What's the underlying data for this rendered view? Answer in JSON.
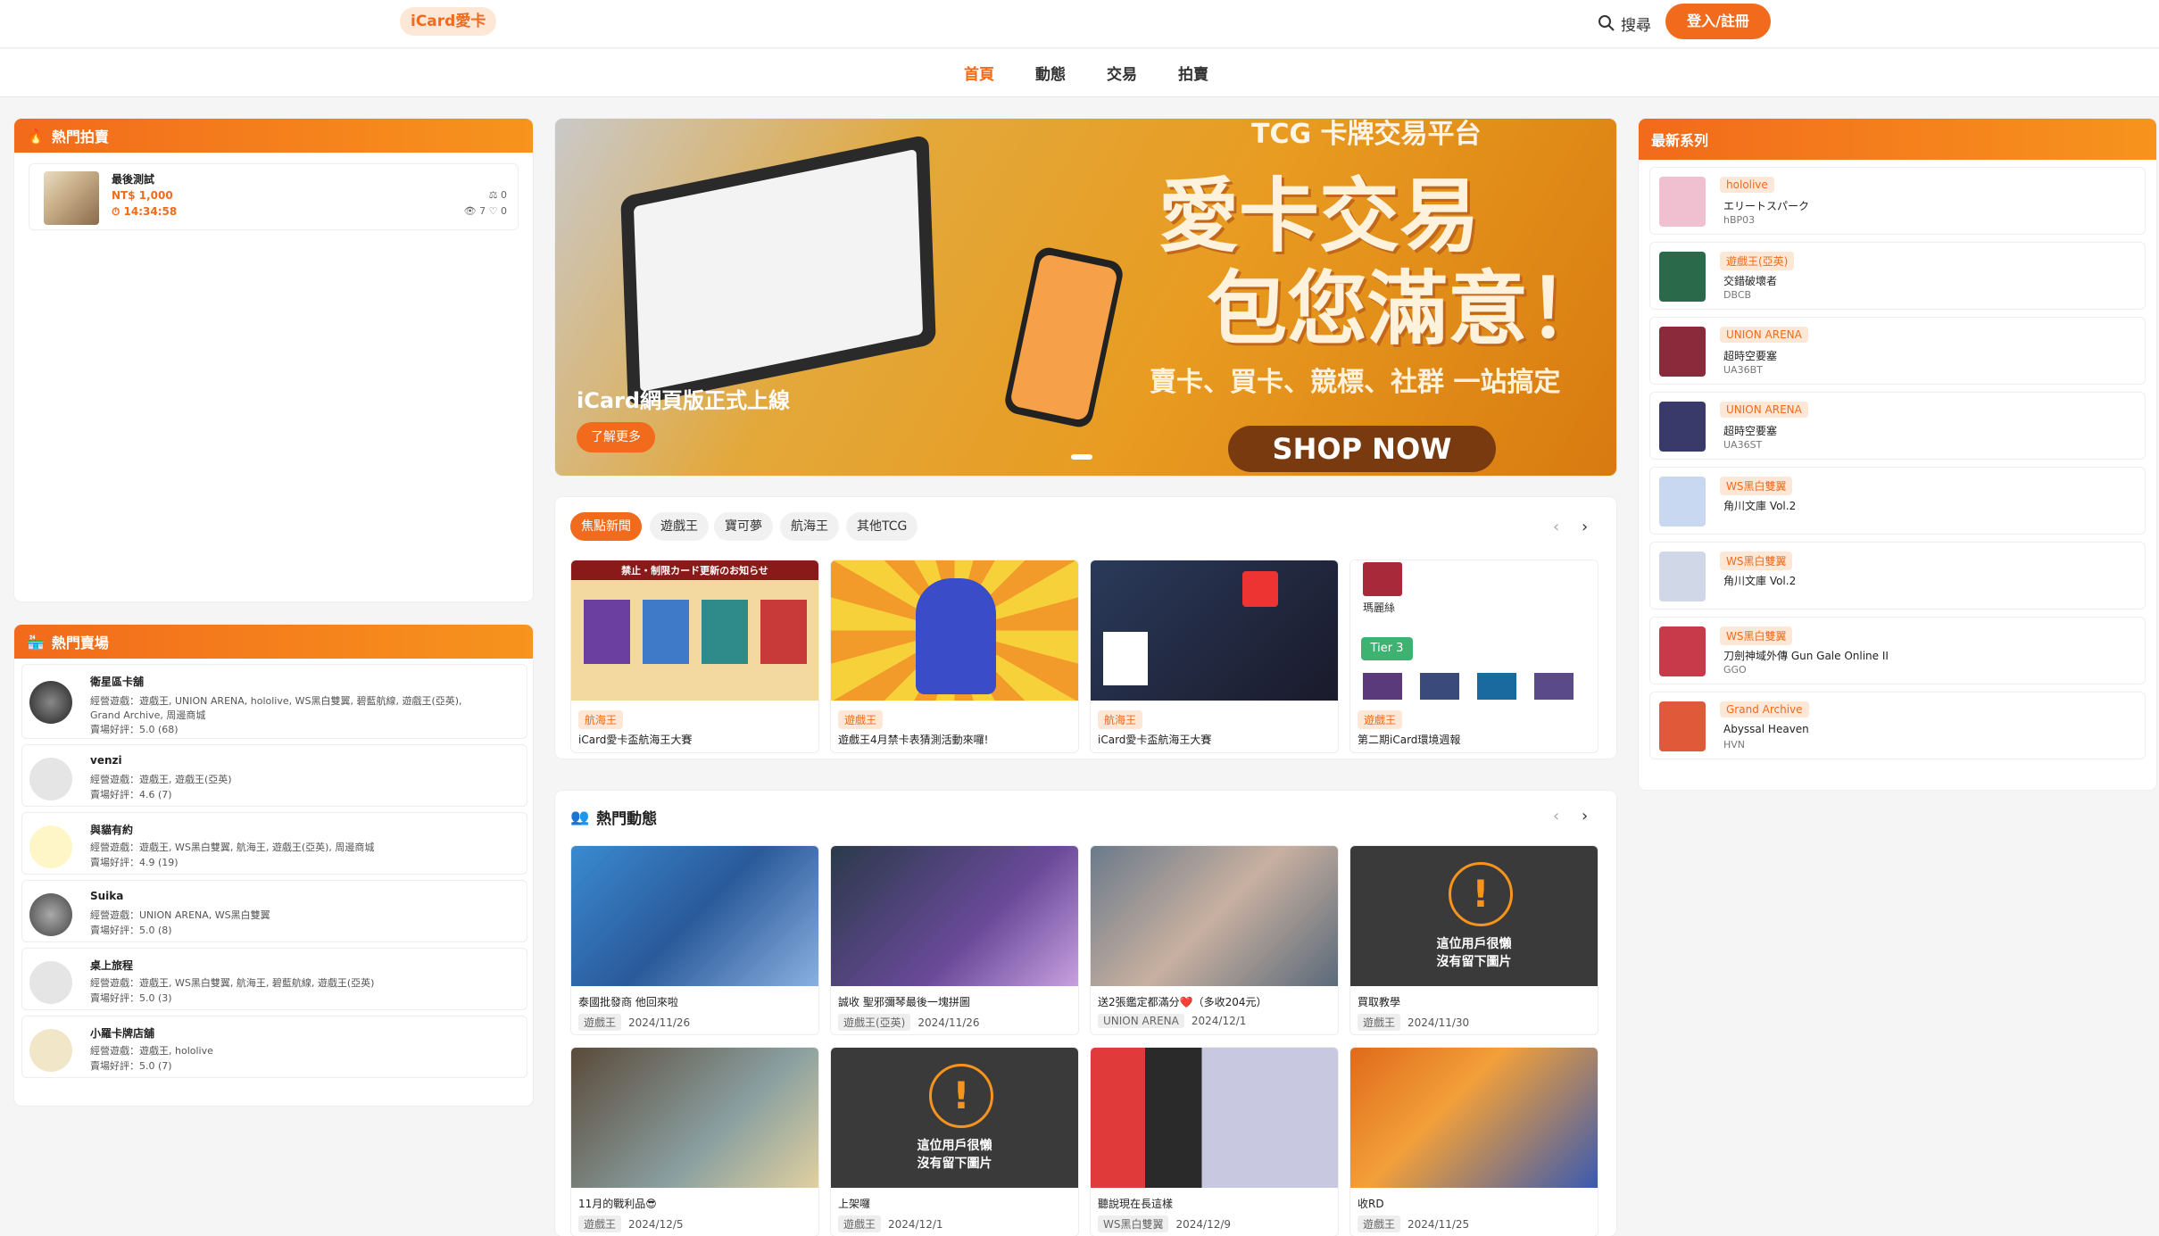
{
  "header": {
    "logo": "iCard愛卡",
    "search": "搜尋",
    "login": "登入/註冊"
  },
  "nav": [
    "首頁",
    "動態",
    "交易",
    "拍賣"
  ],
  "hot_auction": {
    "title": "熱門拍賣",
    "item": {
      "name": "最後測試",
      "price": "NT$ 1,000",
      "time": "14:34:58",
      "bids": "0",
      "views": "7",
      "likes": "0"
    }
  },
  "hot_shops": {
    "title": "熱門賣場",
    "shops": [
      {
        "name": "衛星區卡舖",
        "games": "經營遊戲：遊戲王, UNION ARENA, hololive, WS黑白雙翼, 碧藍航線, 遊戲王(亞英),",
        "games2": "Grand Archive, 周邊商城",
        "rating": "賣場好評：5.0 (68)"
      },
      {
        "name": "venzi",
        "games": "經營遊戲：遊戲王, 遊戲王(亞英)",
        "games2": "",
        "rating": "賣場好評：4.6 (7)"
      },
      {
        "name": "與貓有約",
        "games": "經營遊戲：遊戲王, WS黑白雙翼, 航海王, 遊戲王(亞英), 周邊商城",
        "games2": "",
        "rating": "賣場好評：4.9 (19)"
      },
      {
        "name": "Suika",
        "games": "經營遊戲：UNION ARENA, WS黑白雙翼",
        "games2": "",
        "rating": "賣場好評：5.0 (8)"
      },
      {
        "name": "桌上旅程",
        "games": "經營遊戲：遊戲王, WS黑白雙翼, 航海王, 碧藍航線, 遊戲王(亞英)",
        "games2": "",
        "rating": "賣場好評：5.0 (3)"
      },
      {
        "name": "小羅卡牌店舖",
        "games": "經營遊戲：遊戲王, hololive",
        "games2": "",
        "rating": "賣場好評：5.0 (7)"
      }
    ]
  },
  "banner": {
    "caption": "iCard網頁版正式上線",
    "button": "了解更多",
    "h1": "愛卡交易",
    "h2": "包您滿意！",
    "sub": "賣卡、買卡、競標、社群 一站搞定",
    "shop": "SHOP NOW",
    "top": "TCG 卡牌交易平台"
  },
  "news": {
    "tabs": [
      "焦點新聞",
      "遊戲王",
      "寶可夢",
      "航海王",
      "其他TCG"
    ],
    "cards": [
      {
        "tag": "航海王",
        "title": "iCard愛卡盃航海王大賽"
      },
      {
        "tag": "遊戲王",
        "title": "遊戲王4月禁卡表猜測活動來囉!"
      },
      {
        "tag": "航海王",
        "title": "iCard愛卡盃航海王大賽"
      },
      {
        "tag": "遊戲王",
        "title": "第二期iCard環境週報"
      }
    ],
    "tier": "Tier 3",
    "deck": "瑪麗絲",
    "news_img": "禁止・制限カード更新のお知らせ"
  },
  "feed": {
    "title": "熱門動態",
    "no_image": "這位用戶很懶\n沒有留下圖片",
    "posts": [
      {
        "title": "泰國批發商 他回來啦",
        "tag": "遊戲王",
        "date": "2024/11/26"
      },
      {
        "title": "誠收 聖邪彌琴最後一塊拼圖",
        "tag": "遊戲王(亞英)",
        "date": "2024/11/26"
      },
      {
        "title": "送2張鑑定都滿分❤️（多收204元）",
        "tag": "UNION ARENA",
        "date": "2024/12/1"
      },
      {
        "title": "買取教學",
        "tag": "遊戲王",
        "date": "2024/11/30"
      },
      {
        "title": "11月的戰利品😎",
        "tag": "遊戲王",
        "date": "2024/12/5"
      },
      {
        "title": "上架囉",
        "tag": "遊戲王",
        "date": "2024/12/1"
      },
      {
        "title": "聽說現在長這樣",
        "tag": "WS黑白雙翼",
        "date": "2024/12/9"
      },
      {
        "title": "收RD",
        "tag": "遊戲王",
        "date": "2024/11/25"
      }
    ]
  },
  "series": {
    "title": "最新系列",
    "items": [
      {
        "tag": "hololive",
        "name": "エリートスパーク",
        "code": "hBP03"
      },
      {
        "tag": "遊戲王(亞英)",
        "name": "交錯破壞者",
        "code": "DBCB"
      },
      {
        "tag": "UNION ARENA",
        "name": "超時空要塞",
        "code": "UA36BT"
      },
      {
        "tag": "UNION ARENA",
        "name": "超時空要塞",
        "code": "UA36ST"
      },
      {
        "tag": "WS黑白雙翼",
        "name": "角川文庫 Vol.2",
        "code": ""
      },
      {
        "tag": "WS黑白雙翼",
        "name": "角川文庫 Vol.2",
        "code": ""
      },
      {
        "tag": "WS黑白雙翼",
        "name": "刀劍神域外傳 Gun Gale Online II",
        "code": "GGO"
      },
      {
        "tag": "Grand Archive",
        "name": "Abyssal Heaven",
        "code": "HVN"
      }
    ]
  }
}
